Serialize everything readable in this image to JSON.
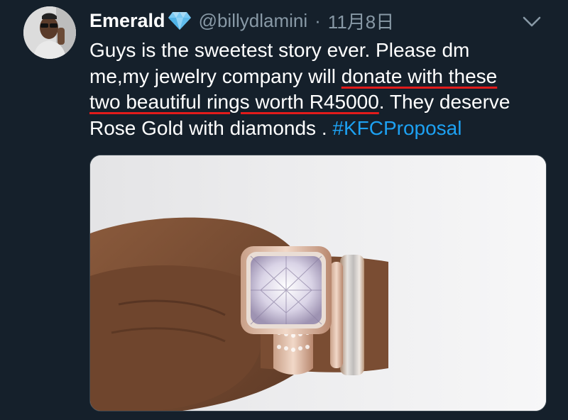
{
  "tweet": {
    "author": {
      "name": "Emerald",
      "handle": "@billydlamini",
      "verified_icon": "diamond-icon"
    },
    "separator": "·",
    "date": "11月8日",
    "text": {
      "l1": "Guys is the sweetest story ever. Please dm",
      "l2a": "me,my jewelry company will ",
      "l2b": "donate with these",
      "l3a": "two beautiful rings worth R45000",
      "l3b": ". They deserve",
      "l4a": "Rose Gold with diamonds . ",
      "l4b": "#KFCProposal"
    },
    "menu_icon": "chevron-down-icon",
    "media": {
      "alt_subject": "rose gold engagement ring with square diamond and wedding band on finger"
    }
  },
  "colors": {
    "background": "#15202b",
    "text": "#ffffff",
    "muted": "#8899a6",
    "link": "#1da1f2",
    "highlight_underline": "#e21b1b",
    "verified": "#6fc4f0"
  }
}
